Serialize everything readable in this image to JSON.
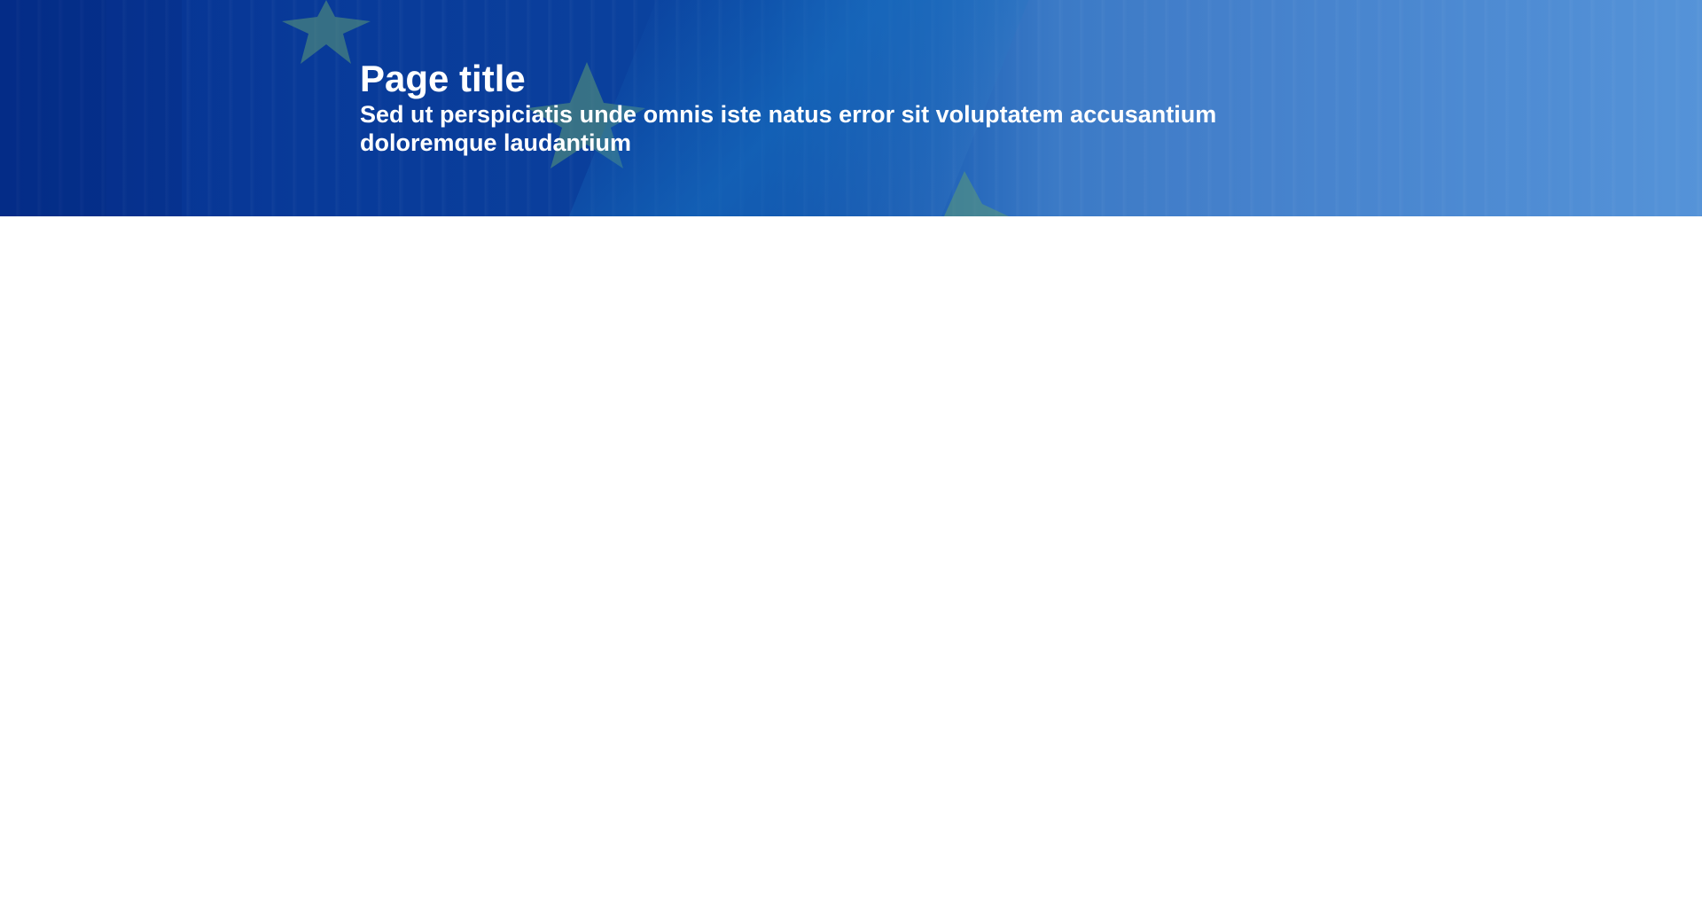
{
  "header": {
    "title": "Page title",
    "subtitle": "Sed ut perspiciatis unde omnis iste natus error sit voluptatem accusantium doloremque laudantium"
  },
  "theme": {
    "background_image": "eu-flag-blue-banner",
    "star_color": "#4f8a70",
    "text_color": "#ffffff"
  }
}
